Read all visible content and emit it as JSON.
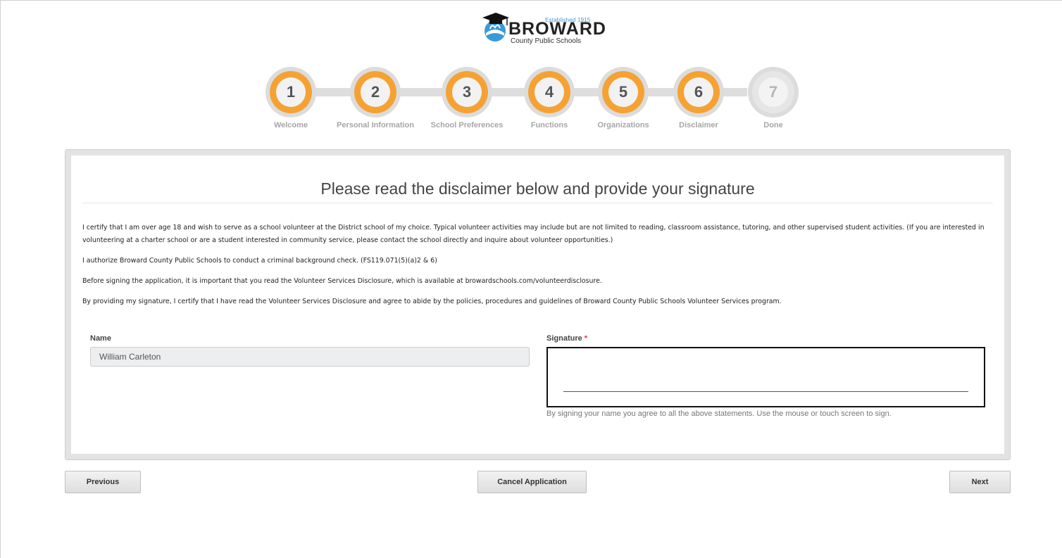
{
  "logo": {
    "established": "Established 1915",
    "brand": "BROWARD",
    "subtitle": "County Public Schools",
    "colors": {
      "blue": "#3a9ad9",
      "dark": "#222222"
    }
  },
  "steps": [
    {
      "number": "1",
      "label": "Welcome",
      "state": "done"
    },
    {
      "number": "2",
      "label": "Personal Information",
      "state": "done"
    },
    {
      "number": "3",
      "label": "School Preferences",
      "state": "done"
    },
    {
      "number": "4",
      "label": "Functions",
      "state": "done"
    },
    {
      "number": "5",
      "label": "Organizations",
      "state": "done"
    },
    {
      "number": "6",
      "label": "Disclaimer",
      "state": "done"
    },
    {
      "number": "7",
      "label": "Done",
      "state": "todo"
    }
  ],
  "colors": {
    "step_accent": "#f5a233",
    "required": "#e0334a"
  },
  "panel": {
    "title": "Please read the disclaimer below and provide your signature",
    "paragraphs": [
      "I certify that I am over age 18 and wish to serve as a school volunteer at the District school of my choice. Typical volunteer activities may include but are not limited to reading, classroom assistance, tutoring, and other supervised student activities. (If you are interested in volunteering at a charter school or are a student interested in community service, please contact the school directly and inquire about volunteer opportunities.)",
      "I authorize Broward County Public Schools to conduct a criminal background check. (FS119.071(5)(a)2 & 6)",
      "Before signing the application, it is important that you read the Volunteer Services Disclosure, which is available at browardschools.com/volunteerdisclosure.",
      "By providing my signature, I certify that I have read the Volunteer Services Disclosure and agree to abide by the policies, procedures and guidelines of Broward County Public Schools Volunteer Services program."
    ],
    "name_label": "Name",
    "name_value": "William Carleton",
    "signature_label": "Signature",
    "required_marker": "*",
    "signature_help": "By signing your name you agree to all the above statements. Use the mouse or touch screen to sign."
  },
  "buttons": {
    "previous": "Previous",
    "cancel": "Cancel Application",
    "next": "Next"
  }
}
